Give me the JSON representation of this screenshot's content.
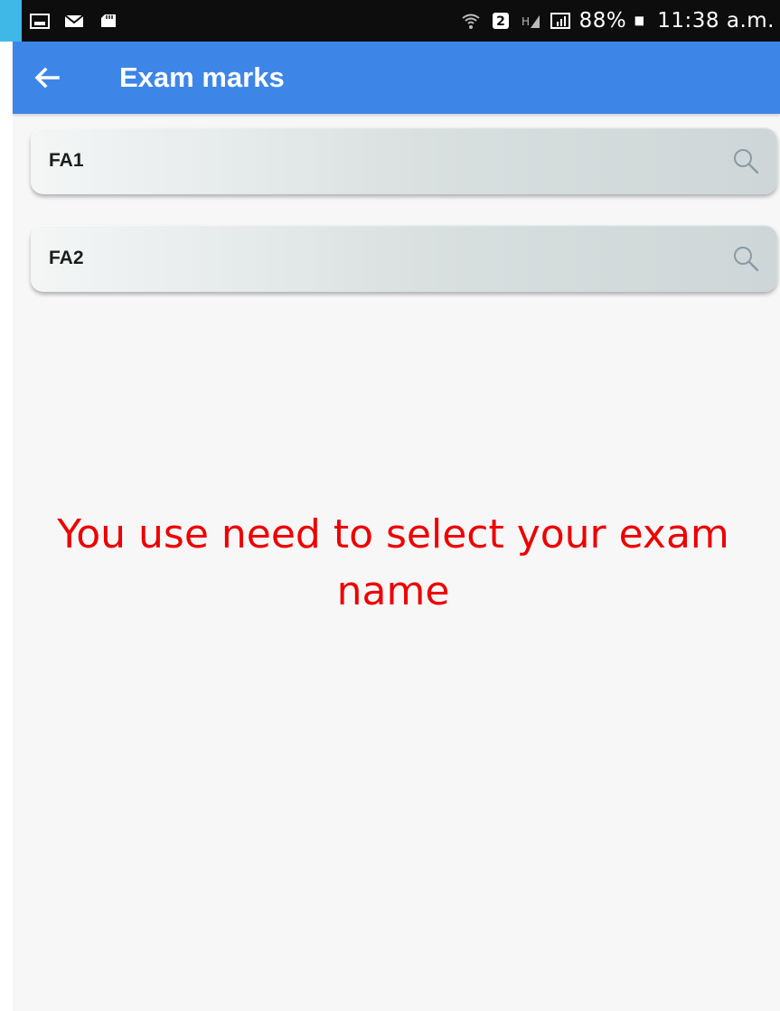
{
  "status_bar": {
    "battery": "88%",
    "time": "11:38 a.m.",
    "left_icons": [
      "image-icon",
      "mail-icon",
      "sd-card-icon"
    ],
    "right_icons": [
      "wifi-icon",
      "sim-2-icon",
      "signal-icon",
      "signal-bars-icon",
      "battery-icon"
    ]
  },
  "app_bar": {
    "title": "Exam marks",
    "back_icon": "arrow-left-icon",
    "color": "#3d86e8"
  },
  "exam_list": [
    {
      "label": "FA1",
      "icon": "search-icon"
    },
    {
      "label": "FA2",
      "icon": "search-icon"
    }
  ],
  "instruction": {
    "text": "You use need to select your exam name",
    "color": "#ee0000"
  }
}
